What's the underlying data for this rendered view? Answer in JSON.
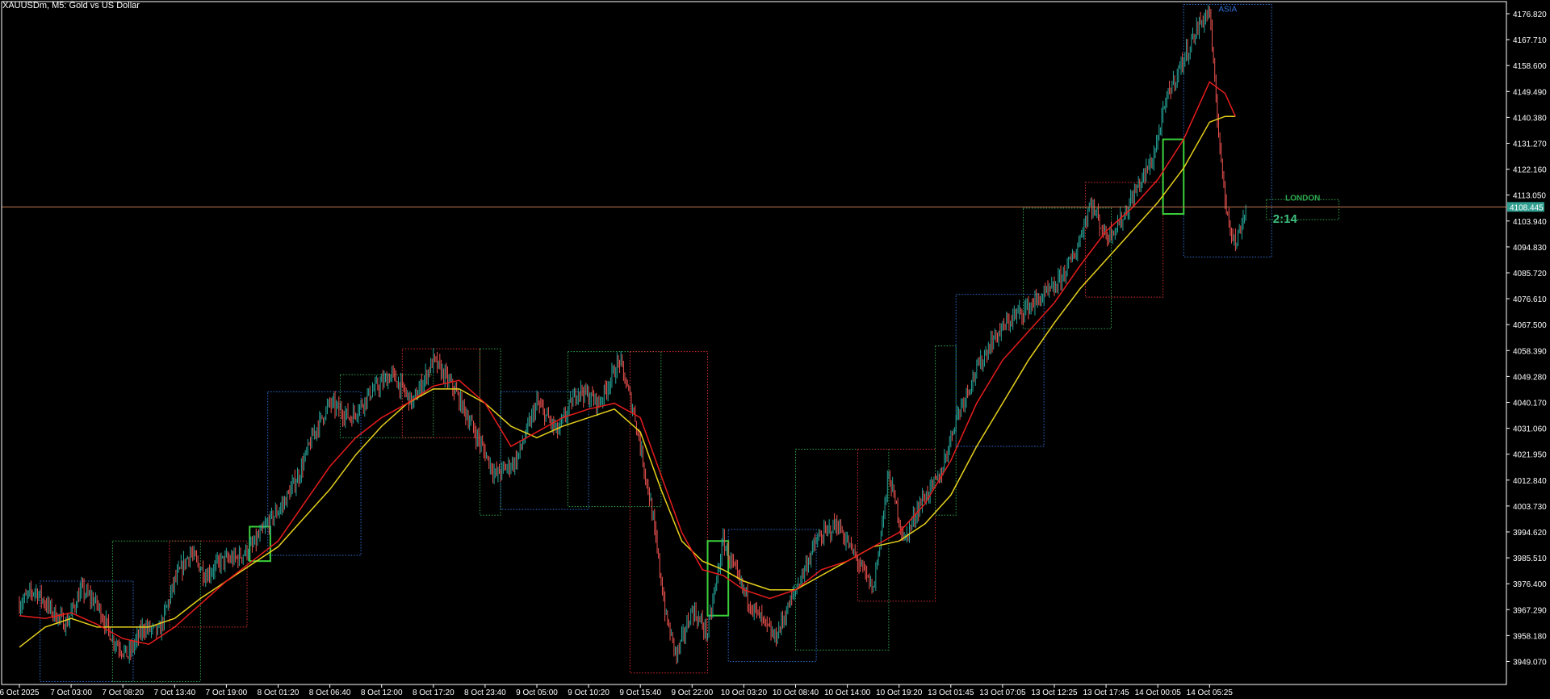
{
  "window": {
    "title": "XAUUSDm, M5:  Gold vs US Dollar"
  },
  "colors": {
    "background": "#000000",
    "axis": "#ffffff",
    "bull": "#26a69a",
    "bear": "#ef5350",
    "ma_fast": "#e81c1c",
    "ma_slow": "#e6d01c",
    "price_line": "#c87850",
    "box_blue": "#2f6fd6",
    "box_red": "#d62f2f",
    "box_green": "#2fa84f",
    "highlight_green": "#3bd13b",
    "price_label_bg": "#2f9e8f",
    "timer_color": "#3fbf7f"
  },
  "chart_data": {
    "type": "candlestick",
    "symbol": "XAUUSDm",
    "timeframe": "M5",
    "ylim": [
      3942.0,
      4180.0
    ],
    "price_ticks": [
      "4176.820",
      "4167.710",
      "4158.600",
      "4149.490",
      "4140.380",
      "4131.270",
      "4122.160",
      "4113.050",
      "4103.940",
      "4094.830",
      "4085.720",
      "4076.610",
      "4067.500",
      "4058.390",
      "4049.280",
      "4040.170",
      "4031.060",
      "4021.950",
      "4012.840",
      "4003.730",
      "3994.620",
      "3985.510",
      "3976.400",
      "3967.290",
      "3958.180",
      "3949.070"
    ],
    "time_ticks": [
      "6 Oct 2025",
      "7 Oct 03:00",
      "7 Oct 08:20",
      "7 Oct 13:40",
      "7 Oct 19:00",
      "8 Oct 01:20",
      "8 Oct 06:40",
      "8 Oct 12:00",
      "8 Oct 17:20",
      "8 Oct 23:40",
      "9 Oct 05:00",
      "9 Oct 10:20",
      "9 Oct 15:40",
      "9 Oct 22:00",
      "10 Oct 03:20",
      "10 Oct 08:40",
      "10 Oct 14:00",
      "10 Oct 19:20",
      "13 Oct 01:45",
      "13 Oct 07:05",
      "13 Oct 12:25",
      "13 Oct 17:45",
      "14 Oct 00:05",
      "14 Oct 05:25"
    ],
    "current_price": "4108.445",
    "current_price_value": 4108.445,
    "price_path": [
      [
        0,
        3970
      ],
      [
        0.3,
        3975
      ],
      [
        0.6,
        3968
      ],
      [
        0.9,
        3963
      ],
      [
        1.2,
        3975
      ],
      [
        1.5,
        3970
      ],
      [
        1.8,
        3958
      ],
      [
        2.1,
        3952
      ],
      [
        2.4,
        3962
      ],
      [
        2.7,
        3960
      ],
      [
        3.0,
        3978
      ],
      [
        3.3,
        3988
      ],
      [
        3.6,
        3980
      ],
      [
        3.9,
        3985
      ],
      [
        4.2,
        3986
      ],
      [
        4.5,
        3990
      ],
      [
        4.8,
        3998
      ],
      [
        5.1,
        4005
      ],
      [
        5.4,
        4015
      ],
      [
        5.7,
        4030
      ],
      [
        6.0,
        4040
      ],
      [
        6.4,
        4035
      ],
      [
        6.8,
        4044
      ],
      [
        7.2,
        4050
      ],
      [
        7.6,
        4040
      ],
      [
        8.0,
        4055
      ],
      [
        8.4,
        4045
      ],
      [
        8.8,
        4030
      ],
      [
        9.2,
        4015
      ],
      [
        9.6,
        4020
      ],
      [
        10.0,
        4040
      ],
      [
        10.4,
        4030
      ],
      [
        10.8,
        4045
      ],
      [
        11.2,
        4040
      ],
      [
        11.6,
        4055
      ],
      [
        11.9,
        4035
      ],
      [
        12.2,
        4005
      ],
      [
        12.5,
        3965
      ],
      [
        12.7,
        3952
      ],
      [
        13.0,
        3968
      ],
      [
        13.3,
        3960
      ],
      [
        13.6,
        3992
      ],
      [
        13.9,
        3978
      ],
      [
        14.2,
        3968
      ],
      [
        14.6,
        3958
      ],
      [
        15.0,
        3975
      ],
      [
        15.4,
        3992
      ],
      [
        15.8,
        3998
      ],
      [
        16.2,
        3985
      ],
      [
        16.5,
        3975
      ],
      [
        16.8,
        4015
      ],
      [
        17.1,
        3992
      ],
      [
        17.4,
        4005
      ],
      [
        17.8,
        4015
      ],
      [
        18.1,
        4035
      ],
      [
        18.4,
        4048
      ],
      [
        18.8,
        4062
      ],
      [
        19.2,
        4070
      ],
      [
        19.6,
        4075
      ],
      [
        20.0,
        4080
      ],
      [
        20.4,
        4092
      ],
      [
        20.7,
        4110
      ],
      [
        21.0,
        4098
      ],
      [
        21.3,
        4104
      ],
      [
        21.6,
        4115
      ],
      [
        21.9,
        4125
      ],
      [
        22.2,
        4148
      ],
      [
        22.5,
        4160
      ],
      [
        22.8,
        4172
      ],
      [
        23.0,
        4177
      ],
      [
        23.1,
        4150
      ],
      [
        23.3,
        4110
      ],
      [
        23.5,
        4095
      ],
      [
        23.7,
        4108
      ]
    ],
    "ma_fast_path": [
      [
        0,
        3966
      ],
      [
        0.5,
        3965
      ],
      [
        1.0,
        3967
      ],
      [
        1.5,
        3963
      ],
      [
        2.0,
        3958
      ],
      [
        2.5,
        3956
      ],
      [
        3.0,
        3962
      ],
      [
        3.5,
        3970
      ],
      [
        4.0,
        3978
      ],
      [
        4.5,
        3985
      ],
      [
        5.0,
        3992
      ],
      [
        5.5,
        4005
      ],
      [
        6.0,
        4018
      ],
      [
        6.5,
        4028
      ],
      [
        7.0,
        4035
      ],
      [
        7.5,
        4040
      ],
      [
        8.0,
        4046
      ],
      [
        8.5,
        4048
      ],
      [
        9.0,
        4040
      ],
      [
        9.5,
        4025
      ],
      [
        10.0,
        4030
      ],
      [
        10.5,
        4035
      ],
      [
        11.0,
        4038
      ],
      [
        11.5,
        4040
      ],
      [
        12.0,
        4035
      ],
      [
        12.4,
        4015
      ],
      [
        12.8,
        3995
      ],
      [
        13.2,
        3982
      ],
      [
        13.6,
        3980
      ],
      [
        14.0,
        3975
      ],
      [
        14.5,
        3972
      ],
      [
        15.0,
        3975
      ],
      [
        15.5,
        3982
      ],
      [
        16.0,
        3985
      ],
      [
        16.5,
        3990
      ],
      [
        17.0,
        3995
      ],
      [
        17.5,
        4005
      ],
      [
        18.0,
        4020
      ],
      [
        18.5,
        4040
      ],
      [
        19.0,
        4055
      ],
      [
        19.5,
        4065
      ],
      [
        20.0,
        4075
      ],
      [
        20.5,
        4088
      ],
      [
        21.0,
        4100
      ],
      [
        21.5,
        4108
      ],
      [
        22.0,
        4118
      ],
      [
        22.5,
        4132
      ],
      [
        23.0,
        4152
      ],
      [
        23.3,
        4148
      ],
      [
        23.5,
        4140
      ]
    ],
    "ma_slow_path": [
      [
        0,
        3955
      ],
      [
        0.5,
        3962
      ],
      [
        1.0,
        3965
      ],
      [
        1.5,
        3962
      ],
      [
        2.0,
        3962
      ],
      [
        2.5,
        3962
      ],
      [
        3.0,
        3965
      ],
      [
        3.5,
        3972
      ],
      [
        4.0,
        3978
      ],
      [
        4.5,
        3984
      ],
      [
        5.0,
        3990
      ],
      [
        5.5,
        4000
      ],
      [
        6.0,
        4010
      ],
      [
        6.5,
        4022
      ],
      [
        7.0,
        4032
      ],
      [
        7.5,
        4040
      ],
      [
        8.0,
        4045
      ],
      [
        8.5,
        4045
      ],
      [
        9.0,
        4040
      ],
      [
        9.5,
        4032
      ],
      [
        10.0,
        4028
      ],
      [
        10.5,
        4032
      ],
      [
        11.0,
        4035
      ],
      [
        11.5,
        4038
      ],
      [
        12.0,
        4030
      ],
      [
        12.4,
        4010
      ],
      [
        12.8,
        3992
      ],
      [
        13.2,
        3985
      ],
      [
        13.6,
        3982
      ],
      [
        14.0,
        3978
      ],
      [
        14.5,
        3975
      ],
      [
        15.0,
        3975
      ],
      [
        15.5,
        3980
      ],
      [
        16.0,
        3985
      ],
      [
        16.5,
        3990
      ],
      [
        17.0,
        3992
      ],
      [
        17.5,
        3998
      ],
      [
        18.0,
        4008
      ],
      [
        18.5,
        4025
      ],
      [
        19.0,
        4040
      ],
      [
        19.5,
        4055
      ],
      [
        20.0,
        4068
      ],
      [
        20.5,
        4080
      ],
      [
        21.0,
        4090
      ],
      [
        21.5,
        4100
      ],
      [
        22.0,
        4110
      ],
      [
        22.5,
        4122
      ],
      [
        23.0,
        4138
      ],
      [
        23.3,
        4140
      ],
      [
        23.5,
        4140
      ]
    ],
    "session_boxes": [
      {
        "color": "blue",
        "t0": 0.4,
        "t1": 2.2,
        "lo": 3943,
        "hi": 3978
      },
      {
        "color": "green",
        "t0": 1.8,
        "t1": 3.5,
        "lo": 3943,
        "hi": 3992
      },
      {
        "color": "red",
        "t0": 2.9,
        "t1": 4.4,
        "lo": 3962,
        "hi": 3992
      },
      {
        "color": "blue",
        "t0": 4.8,
        "t1": 6.6,
        "lo": 3987,
        "hi": 4044
      },
      {
        "color": "green",
        "t0": 6.2,
        "t1": 8.0,
        "lo": 4028,
        "hi": 4050
      },
      {
        "color": "red",
        "t0": 7.4,
        "t1": 8.9,
        "lo": 4028,
        "hi": 4059
      },
      {
        "color": "green",
        "t0": 8.9,
        "t1": 9.3,
        "lo": 4001,
        "hi": 4059
      },
      {
        "color": "blue",
        "t0": 9.3,
        "t1": 11.0,
        "lo": 4003,
        "hi": 4044
      },
      {
        "color": "green",
        "t0": 10.6,
        "t1": 12.4,
        "lo": 4004,
        "hi": 4058
      },
      {
        "color": "red",
        "t0": 11.8,
        "t1": 13.3,
        "lo": 3946,
        "hi": 4058
      },
      {
        "color": "blue",
        "t0": 13.7,
        "t1": 15.4,
        "lo": 3950,
        "hi": 3996
      },
      {
        "color": "green",
        "t0": 15.0,
        "t1": 16.8,
        "lo": 3954,
        "hi": 4024
      },
      {
        "color": "red",
        "t0": 16.2,
        "t1": 17.7,
        "lo": 3971,
        "hi": 4024
      },
      {
        "color": "green",
        "t0": 17.7,
        "t1": 18.1,
        "lo": 4001,
        "hi": 4060
      },
      {
        "color": "blue",
        "t0": 18.1,
        "t1": 19.8,
        "lo": 4025,
        "hi": 4078
      },
      {
        "color": "green",
        "t0": 19.4,
        "t1": 21.1,
        "lo": 4066,
        "hi": 4108
      },
      {
        "color": "red",
        "t0": 20.6,
        "t1": 22.1,
        "lo": 4077,
        "hi": 4117
      },
      {
        "color": "blue",
        "t0": 22.5,
        "t1": 24.2,
        "lo": 4091,
        "hi": 4179
      }
    ],
    "highlight_boxes": [
      {
        "t0": 4.45,
        "t1": 4.85,
        "lo": 3985,
        "hi": 3997
      },
      {
        "t0": 13.3,
        "t1": 13.7,
        "lo": 3966,
        "hi": 3992
      },
      {
        "t0": 22.1,
        "t1": 22.5,
        "lo": 4106,
        "hi": 4132
      }
    ],
    "labels": {
      "asia": "ASIA",
      "london": "LONDON",
      "timer": "2:14"
    },
    "london_box": {
      "t0": 24.1,
      "t1": 25.5,
      "lo": 4104,
      "hi": 4111
    }
  }
}
